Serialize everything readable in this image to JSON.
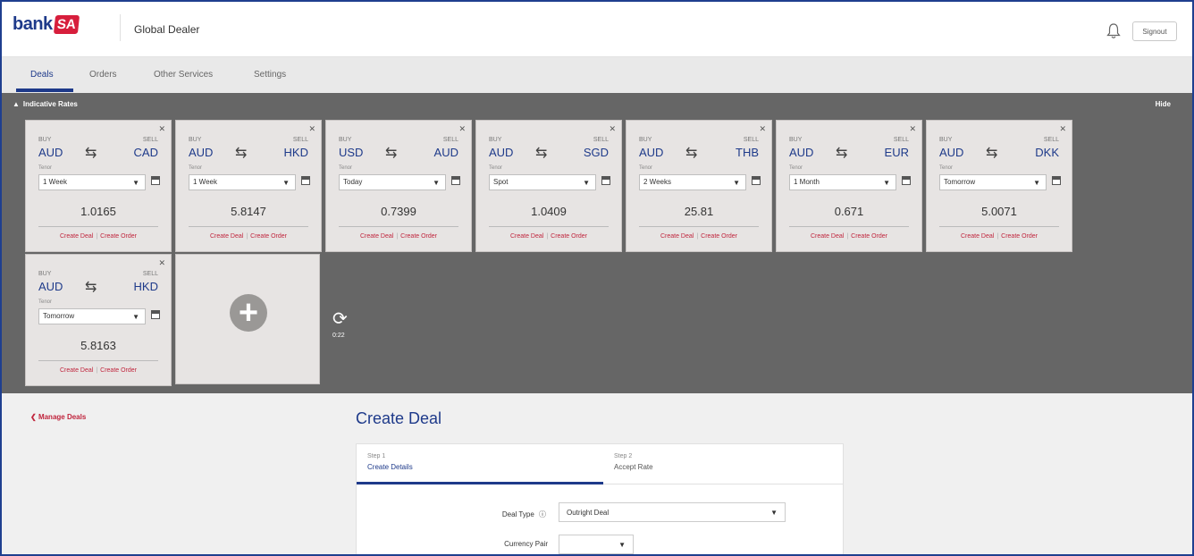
{
  "header": {
    "logo_text": "bank",
    "logo_badge": "SA",
    "app_title": "Global Dealer",
    "signout_label": "Signout"
  },
  "tabs": [
    {
      "label": "Deals",
      "active": true
    },
    {
      "label": "Orders",
      "active": false
    },
    {
      "label": "Other Services",
      "active": false
    },
    {
      "label": "Settings",
      "active": false
    }
  ],
  "rates_panel": {
    "title": "Indicative Rates",
    "hide_label": "Hide",
    "refresh_time": "0:22",
    "cards": [
      {
        "buy_label": "BUY",
        "buy": "AUD",
        "sell_label": "SELL",
        "sell": "CAD",
        "tenor_label": "Tenor",
        "tenor": "1 Week",
        "rate": "1.0165",
        "create_deal": "Create Deal",
        "create_order": "Create Order"
      },
      {
        "buy_label": "BUY",
        "buy": "AUD",
        "sell_label": "SELL",
        "sell": "HKD",
        "tenor_label": "Tenor",
        "tenor": "1 Week",
        "rate": "5.8147",
        "create_deal": "Create Deal",
        "create_order": "Create Order"
      },
      {
        "buy_label": "BUY",
        "buy": "USD",
        "sell_label": "SELL",
        "sell": "AUD",
        "tenor_label": "Tenor",
        "tenor": "Today",
        "rate": "0.7399",
        "create_deal": "Create Deal",
        "create_order": "Create Order"
      },
      {
        "buy_label": "BUY",
        "buy": "AUD",
        "sell_label": "SELL",
        "sell": "SGD",
        "tenor_label": "Tenor",
        "tenor": "Spot",
        "rate": "1.0409",
        "create_deal": "Create Deal",
        "create_order": "Create Order"
      },
      {
        "buy_label": "BUY",
        "buy": "AUD",
        "sell_label": "SELL",
        "sell": "THB",
        "tenor_label": "Tenor",
        "tenor": "2 Weeks",
        "rate": "25.81",
        "create_deal": "Create Deal",
        "create_order": "Create Order"
      },
      {
        "buy_label": "BUY",
        "buy": "AUD",
        "sell_label": "SELL",
        "sell": "EUR",
        "tenor_label": "Tenor",
        "tenor": "1 Month",
        "rate": "0.671",
        "create_deal": "Create Deal",
        "create_order": "Create Order"
      },
      {
        "buy_label": "BUY",
        "buy": "AUD",
        "sell_label": "SELL",
        "sell": "DKK",
        "tenor_label": "Tenor",
        "tenor": "Tomorrow",
        "rate": "5.0071",
        "create_deal": "Create Deal",
        "create_order": "Create Order"
      },
      {
        "buy_label": "BUY",
        "buy": "AUD",
        "sell_label": "SELL",
        "sell": "HKD",
        "tenor_label": "Tenor",
        "tenor": "Tomorrow",
        "rate": "5.8163",
        "create_deal": "Create Deal",
        "create_order": "Create Order"
      }
    ]
  },
  "manage": {
    "label": "Manage Deals"
  },
  "create_deal": {
    "title": "Create Deal",
    "steps": [
      {
        "number": "Step 1",
        "name": "Create Details"
      },
      {
        "number": "Step 2",
        "name": "Accept Rate"
      }
    ],
    "deal_type_label": "Deal Type",
    "deal_type_value": "Outright Deal",
    "currency_pair_label": "Currency Pair",
    "currency_pair_value": ""
  }
}
